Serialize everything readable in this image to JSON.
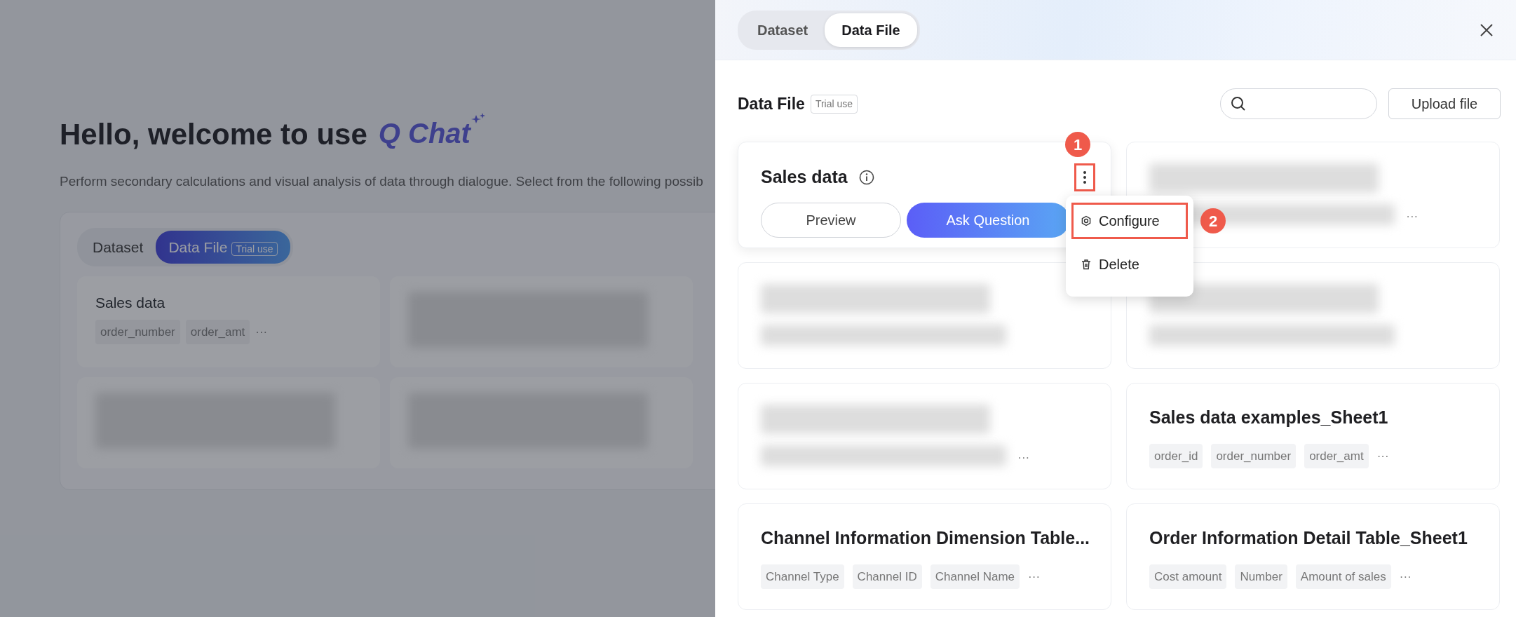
{
  "background_page": {
    "title": "Hello, welcome to use",
    "brand": "Q Chat",
    "subtitle": "Perform secondary calculations and visual analysis of data through dialogue. Select from the following possib",
    "tabs": [
      {
        "label": "Dataset",
        "selected": false
      },
      {
        "label": "Data File",
        "selected": true,
        "badge": "Trial use"
      }
    ],
    "cards": [
      {
        "kind": "file",
        "title": "Sales data",
        "fields": [
          "order_number",
          "order_amt"
        ],
        "more": "···"
      },
      {
        "kind": "blurred"
      },
      {
        "kind": "blurred"
      },
      {
        "kind": "blurred"
      }
    ]
  },
  "drawer": {
    "tabs": [
      {
        "label": "Dataset",
        "selected": false
      },
      {
        "label": "Data File",
        "selected": true
      }
    ],
    "heading": "Data File",
    "badge": "Trial use",
    "upload_button": "Upload file",
    "cards": [
      {
        "kind": "active",
        "title": "Sales data",
        "menu_highlighted": true,
        "annotation": "1",
        "buttons": [
          {
            "label": "Preview",
            "kind": "outline"
          },
          {
            "label": "Ask Question",
            "kind": "primary"
          }
        ],
        "menu": [
          {
            "label": "Configure",
            "kind": "configure",
            "highlighted": true,
            "annotation": "2"
          },
          {
            "label": "Delete",
            "kind": "delete",
            "highlighted": false
          }
        ]
      },
      {
        "kind": "blurred",
        "more": "···"
      },
      {
        "kind": "blurred"
      },
      {
        "kind": "blurred"
      },
      {
        "kind": "blurred",
        "more": "···"
      },
      {
        "kind": "file",
        "title": "Sales data examples_Sheet1",
        "fields": [
          "order_id",
          "order_number",
          "order_amt"
        ],
        "more": "···"
      },
      {
        "kind": "file",
        "title": "Channel Information Dimension Table...",
        "fields": [
          "Channel Type",
          "Channel ID",
          "Channel Name"
        ],
        "more": "···"
      },
      {
        "kind": "file",
        "title": "Order Information Detail Table_Sheet1",
        "fields": [
          "Cost amount",
          "Number",
          "Amount of sales"
        ],
        "more": "···"
      }
    ]
  }
}
